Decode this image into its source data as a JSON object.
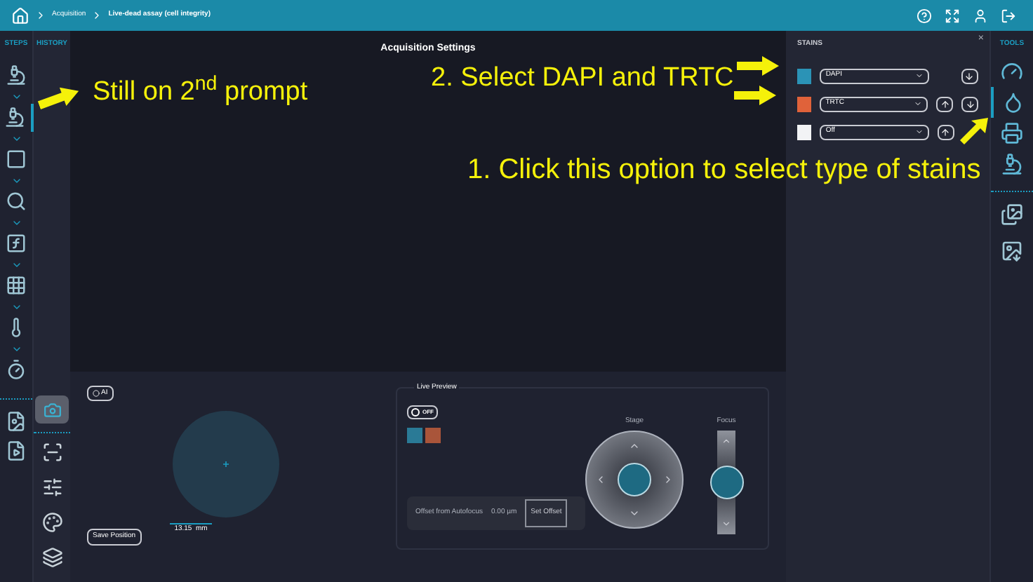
{
  "breadcrumb": [
    "Acquisition",
    "Live-dead assay (cell integrity)"
  ],
  "steps_panel": {
    "label": "STEPS",
    "items": [
      {
        "kind": "microscopes",
        "selected": false
      },
      {
        "kind": "microscope",
        "selected": true
      },
      {
        "kind": "region",
        "selected": false
      },
      {
        "kind": "magnifier",
        "selected": false
      },
      {
        "kind": "function",
        "selected": false
      },
      {
        "kind": "wellplate",
        "selected": false
      },
      {
        "kind": "environment",
        "selected": false
      },
      {
        "kind": "timer",
        "selected": false
      }
    ],
    "files": [
      {
        "kind": "export"
      },
      {
        "kind": "run"
      }
    ]
  },
  "history_panel": {
    "label": "HISTORY",
    "camera": {
      "selected": true
    },
    "tools": [
      {
        "kind": "autofocus"
      },
      {
        "kind": "sliders"
      },
      {
        "kind": "channels"
      },
      {
        "kind": "zstack"
      }
    ]
  },
  "main": {
    "title": "Acquisition Settings"
  },
  "stains_panel": {
    "title": "STAINS",
    "close": "×",
    "rows": [
      {
        "color": "#2b93b6",
        "value": "DAPI",
        "up": false,
        "down": true
      },
      {
        "color": "#e0623a",
        "value": "TRTC",
        "up": true,
        "down": true
      },
      {
        "color": "#f2f3f5",
        "value": "Off",
        "up": true,
        "down": false
      }
    ]
  },
  "tools_panel": {
    "label": "TOOLS",
    "items": [
      {
        "kind": "dial",
        "selected": false
      },
      {
        "kind": "stain",
        "selected": true
      },
      {
        "kind": "stage",
        "selected": false
      },
      {
        "kind": "scope-info",
        "selected": false
      }
    ],
    "extras": [
      {
        "kind": "snapshots"
      },
      {
        "kind": "image-download"
      }
    ]
  },
  "bottom": {
    "ai_button": "AI",
    "save_position": "Save Position",
    "scale": "13.15  mm",
    "live_preview": {
      "title": "Live Preview",
      "toggle": {
        "label": "OFF",
        "on": false
      },
      "channels": [
        {
          "color": "#2a7a96"
        },
        {
          "color": "#a9553a"
        }
      ],
      "offset_label": "Offset from Autofocus",
      "offset_value": "0.00 µm",
      "set_offset": "Set Offset",
      "stage_label": "Stage",
      "focus": {
        "label": "Focus",
        "level": 0.5
      }
    }
  },
  "annotations": [
    {
      "text": "Still on 2$^{nd}$ prompt"
    },
    {
      "text": "2. Select DAPI and TRTC"
    },
    {
      "text": "1. Click this option to select type of stains"
    }
  ]
}
